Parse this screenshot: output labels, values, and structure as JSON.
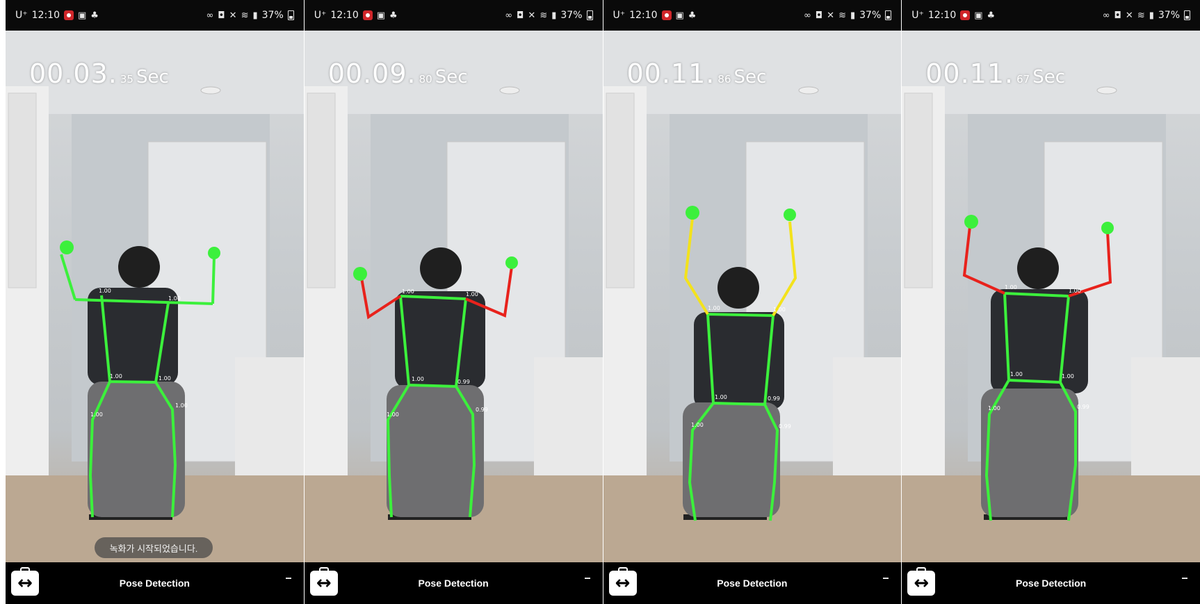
{
  "status_bar": {
    "carrier": "U⁺",
    "time": "12:10",
    "battery": "37%"
  },
  "frames": [
    {
      "timer_main": "00.03.",
      "timer_frac": "35",
      "timer_unit": "Sec",
      "toast": "녹화가 시작되었습니다.",
      "arm_color": "#3cf03c",
      "scores": [
        "1.00",
        "1.00",
        "1.00",
        "1.00",
        "1.00",
        "1.00"
      ]
    },
    {
      "timer_main": "00.09.",
      "timer_frac": "80",
      "timer_unit": "Sec",
      "arm_color": "#e8221c",
      "scores": [
        "1.00",
        "1.00",
        "1.00",
        "0.99",
        "1.00",
        "0.99"
      ]
    },
    {
      "timer_main": "00.11.",
      "timer_frac": "86",
      "timer_unit": "Sec",
      "arm_color": "#f3e21c",
      "scores": [
        "1.00",
        "1.00",
        "1.00",
        "0.99",
        "1.00",
        "0.99"
      ]
    },
    {
      "timer_main": "00.11.",
      "timer_frac": "67",
      "timer_unit": "Sec",
      "arm_color": "#e8221c",
      "scores": [
        "1.00",
        "1.00",
        "1.00",
        "1.00",
        "1.00",
        "0.99"
      ]
    }
  ],
  "bottom_bar": {
    "mode_label": "Pose Detection",
    "swap_icon": "↔",
    "swap_icon_name": "swap-camera-icon",
    "caret_icon_name": "dropdown-caret-icon"
  },
  "colors": {
    "skeleton_green": "#3cf03c",
    "pose_red": "#e8221c",
    "pose_yellow": "#f3e21c"
  }
}
